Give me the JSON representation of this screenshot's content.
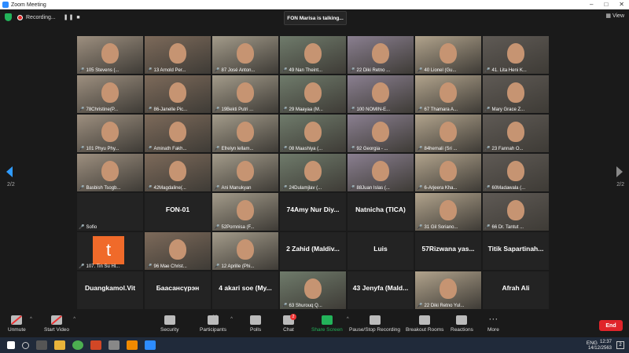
{
  "window": {
    "title": "Zoom Meeting"
  },
  "top": {
    "recording": "Recording...",
    "talking": "FON Marisa is talking...",
    "view": "View"
  },
  "pager": {
    "left": "2/2",
    "right": "2/2"
  },
  "tiles": [
    {
      "label": "105 Stevens (...",
      "type": "video"
    },
    {
      "label": "13 Arnold Per...",
      "type": "video"
    },
    {
      "label": "87 José Anton...",
      "type": "video"
    },
    {
      "label": "49 Nan Theint...",
      "type": "video"
    },
    {
      "label": "22 Diki Retno ...",
      "type": "video"
    },
    {
      "label": "40 Lionel (Gu...",
      "type": "video"
    },
    {
      "label": "41. Lita Heni K...",
      "type": "video"
    },
    {
      "label": "78Christine(P...",
      "type": "video"
    },
    {
      "label": "86-Janelle Pic...",
      "type": "video"
    },
    {
      "label": "19Bekti Putri ...",
      "type": "video"
    },
    {
      "label": "29 Maayaa (M...",
      "type": "video"
    },
    {
      "label": "100 NOMIN-E...",
      "type": "video"
    },
    {
      "label": "67 Thamara A...",
      "type": "video"
    },
    {
      "label": "Mary Grace Z...",
      "type": "video"
    },
    {
      "label": "101 Phyu Phy...",
      "type": "video"
    },
    {
      "label": "Aminath Fakh...",
      "type": "video"
    },
    {
      "label": "Efrelyn lellam...",
      "type": "video"
    },
    {
      "label": "08 Maashiya (...",
      "type": "video"
    },
    {
      "label": "92 Georgia - ...",
      "type": "video"
    },
    {
      "label": "84hemali (Sri ...",
      "type": "video"
    },
    {
      "label": "23 Fannah O...",
      "type": "video"
    },
    {
      "label": "Basbish Tsogb...",
      "type": "video"
    },
    {
      "label": "42Magdaline(...",
      "type": "video"
    },
    {
      "label": "Ani Manukyan",
      "type": "video"
    },
    {
      "label": "24Dulamjlav (...",
      "type": "video"
    },
    {
      "label": "88Juan Islas (...",
      "type": "video"
    },
    {
      "label": "6-Arjeera Kha...",
      "type": "video"
    },
    {
      "label": "60Madawala (...",
      "type": "video"
    },
    {
      "label": "Sofio",
      "type": "name",
      "big": ""
    },
    {
      "label": "",
      "type": "name",
      "big": "FON-01"
    },
    {
      "label": "52Pornnisa (F...",
      "type": "video"
    },
    {
      "label": "",
      "type": "name",
      "big": "74Amy Nur Diy..."
    },
    {
      "label": "",
      "type": "name",
      "big": "Natnicha (TICA)"
    },
    {
      "label": "31 Gil Soriano...",
      "type": "video"
    },
    {
      "label": "66 Dr. Tantut ...",
      "type": "video"
    },
    {
      "label": "107. Tin Su Hl...",
      "type": "logo",
      "big": "t"
    },
    {
      "label": "96 Mae Christ...",
      "type": "video"
    },
    {
      "label": "12 Aprille (Phi...",
      "type": "video"
    },
    {
      "label": "",
      "type": "name",
      "big": "2 Zahid (Maldiv..."
    },
    {
      "label": "",
      "type": "name",
      "big": "Luis"
    },
    {
      "label": "",
      "type": "name",
      "big": "57Rizwana yas..."
    },
    {
      "label": "",
      "type": "name",
      "big": "Titik Sapartinah..."
    },
    {
      "label": "",
      "type": "name",
      "big": "Duangkamol.Vit"
    },
    {
      "label": "",
      "type": "name",
      "big": "Баасансүрэн"
    },
    {
      "label": "",
      "type": "name",
      "big": "4 akari soe (My..."
    },
    {
      "label": "63 Shurouq Q...",
      "type": "video"
    },
    {
      "label": "",
      "type": "name",
      "big": "43 Jenyfa (Mald..."
    },
    {
      "label": "22 Diki Retno Yul...",
      "type": "video"
    },
    {
      "label": "",
      "type": "name",
      "big": "Afrah Ali"
    }
  ],
  "toolbar": {
    "unmute": "Unmute",
    "start_video": "Start Video",
    "security": "Security",
    "participants": "Participants",
    "participants_count": "90",
    "polls": "Polls",
    "chat": "Chat",
    "chat_badge": "2",
    "share": "Share Screen",
    "record": "Pause/Stop Recording",
    "breakout": "Breakout Rooms",
    "reactions": "Reactions",
    "more": "More",
    "end": "End"
  },
  "taskbar": {
    "lang": "ENG",
    "time": "12:37",
    "date": "14/12/2563",
    "notifications": "2"
  },
  "colors": {
    "accent": "#2d8cff",
    "end": "#e0242a",
    "share": "#23b35a"
  }
}
